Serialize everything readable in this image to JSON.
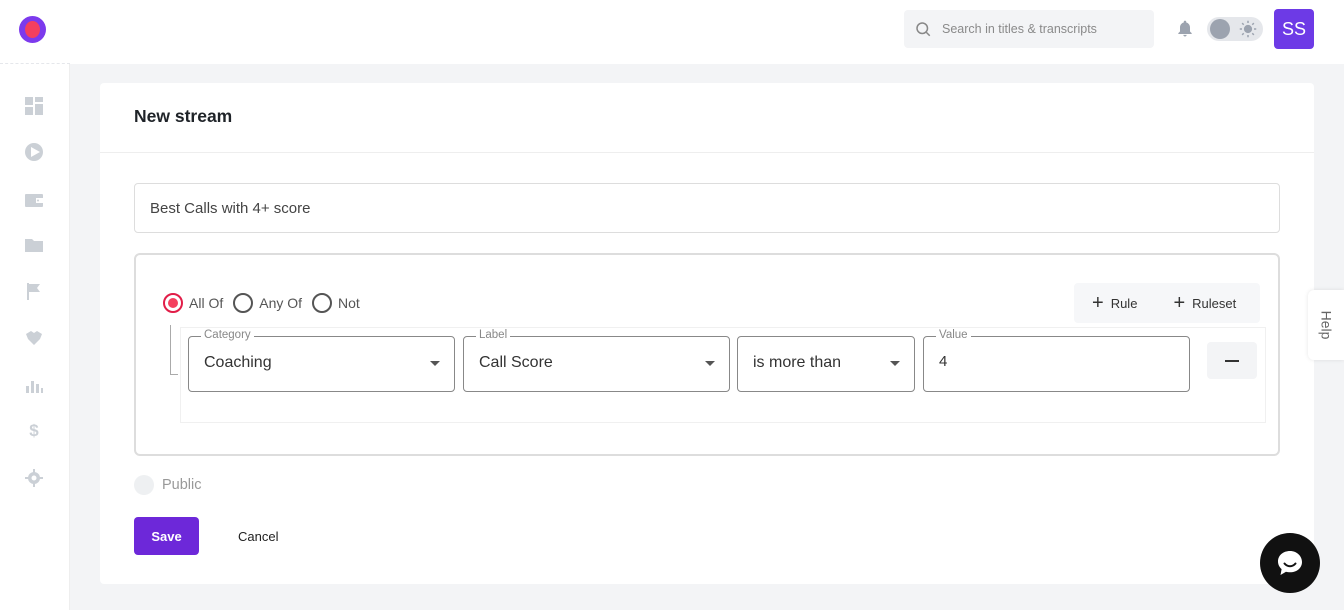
{
  "header": {
    "search_placeholder": "Search in titles & transcripts",
    "avatar_initials": "SS"
  },
  "sidebar": {
    "items": [
      {
        "icon": "dashboard-icon"
      },
      {
        "icon": "play-icon"
      },
      {
        "icon": "wallet-icon"
      },
      {
        "icon": "folder-icon"
      },
      {
        "icon": "flag-icon"
      },
      {
        "icon": "handshake-icon"
      },
      {
        "icon": "bar-chart-icon"
      },
      {
        "icon": "dollar-icon"
      },
      {
        "icon": "settings-icon"
      }
    ]
  },
  "form": {
    "title": "New stream",
    "stream_name": "Best Calls with 4+ score",
    "match_options": [
      {
        "label": "All Of",
        "checked": true
      },
      {
        "label": "Any Of",
        "checked": false
      },
      {
        "label": "Not",
        "checked": false
      }
    ],
    "add_rule_label": "Rule",
    "add_ruleset_label": "Ruleset",
    "rule": {
      "category_legend": "Category",
      "category_value": "Coaching",
      "label_legend": "Label",
      "label_value": "Call Score",
      "operator_value": "is more than",
      "value_legend": "Value",
      "value_value": "4"
    },
    "public_label": "Public",
    "save_label": "Save",
    "cancel_label": "Cancel"
  },
  "help_label": "Help",
  "colors": {
    "primary": "#6d28d9",
    "radio_checked": "#f43f5e",
    "avatar_bg": "#6d3ae6"
  }
}
